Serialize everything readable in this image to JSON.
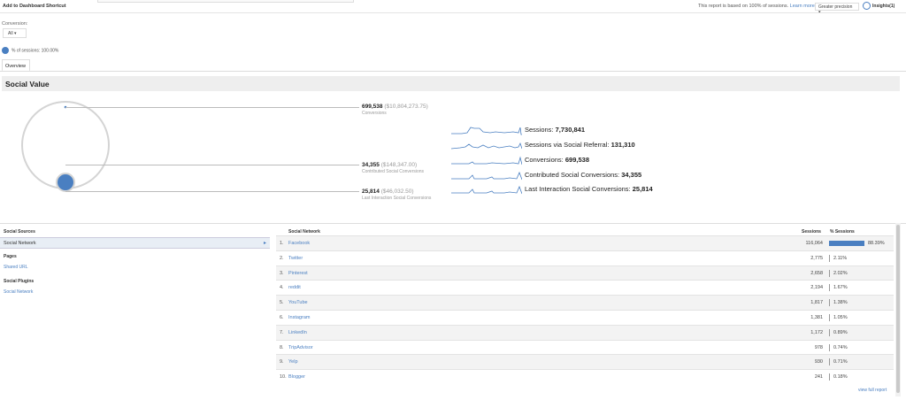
{
  "topbar": {
    "add_dashboard": "Add to Dashboard",
    "shortcut": "Shortcut",
    "sampling": "This report is based on 100% of sessions.",
    "learn_more": "Learn more",
    "precision": "Greater precision",
    "insights": "Insights(1)"
  },
  "controls": {
    "conversion_label": "Conversion:",
    "conversion_value": "All",
    "sessions_legend": "% of sessions: 100.00%",
    "tab_overview": "Overview"
  },
  "section_title": "Social Value",
  "conversions": [
    {
      "value": "699,538",
      "money": "($10,804,273.75)",
      "label": "Conversions"
    },
    {
      "value": "34,355",
      "money": "($148,347.00)",
      "label": "Contributed Social Conversions"
    },
    {
      "value": "25,814",
      "money": "($46,032.50)",
      "label": "Last Interaction Social Conversions"
    }
  ],
  "sparklines": [
    {
      "label": "Sessions:",
      "value": "7,730,841"
    },
    {
      "label": "Sessions via Social Referral:",
      "value": "131,310"
    },
    {
      "label": "Conversions:",
      "value": "699,538"
    },
    {
      "label": "Contributed Social Conversions:",
      "value": "34,355"
    },
    {
      "label": "Last Interaction Social Conversions:",
      "value": "25,814"
    }
  ],
  "left_panel": {
    "social_sources": "Social Sources",
    "social_network": "Social Network",
    "pages": "Pages",
    "shared_url": "Shared URL",
    "social_plugins": "Social Plugins",
    "plugins_network": "Social Network"
  },
  "table": {
    "col_network": "Social Network",
    "col_sessions": "Sessions",
    "col_pct": "% Sessions",
    "rows": [
      {
        "idx": "1.",
        "name": "Facebook",
        "sessions": "116,064",
        "pct": "88.39%",
        "share": 0.8839
      },
      {
        "idx": "2.",
        "name": "Twitter",
        "sessions": "2,775",
        "pct": "2.11%",
        "share": 0.0211
      },
      {
        "idx": "3.",
        "name": "Pinterest",
        "sessions": "2,658",
        "pct": "2.02%",
        "share": 0.0202
      },
      {
        "idx": "4.",
        "name": "reddit",
        "sessions": "2,194",
        "pct": "1.67%",
        "share": 0.0167
      },
      {
        "idx": "5.",
        "name": "YouTube",
        "sessions": "1,817",
        "pct": "1.38%",
        "share": 0.0138
      },
      {
        "idx": "6.",
        "name": "Instagram",
        "sessions": "1,381",
        "pct": "1.05%",
        "share": 0.0105
      },
      {
        "idx": "7.",
        "name": "LinkedIn",
        "sessions": "1,172",
        "pct": "0.89%",
        "share": 0.0089
      },
      {
        "idx": "8.",
        "name": "TripAdvisor",
        "sessions": "978",
        "pct": "0.74%",
        "share": 0.0074
      },
      {
        "idx": "9.",
        "name": "Yelp",
        "sessions": "930",
        "pct": "0.71%",
        "share": 0.0071
      },
      {
        "idx": "10.",
        "name": "Blogger",
        "sessions": "241",
        "pct": "0.18%",
        "share": 0.0018
      }
    ],
    "view_full": "view full report"
  },
  "colors": {
    "accent": "#4a7fc1",
    "header_bg": "#eeeeee"
  }
}
